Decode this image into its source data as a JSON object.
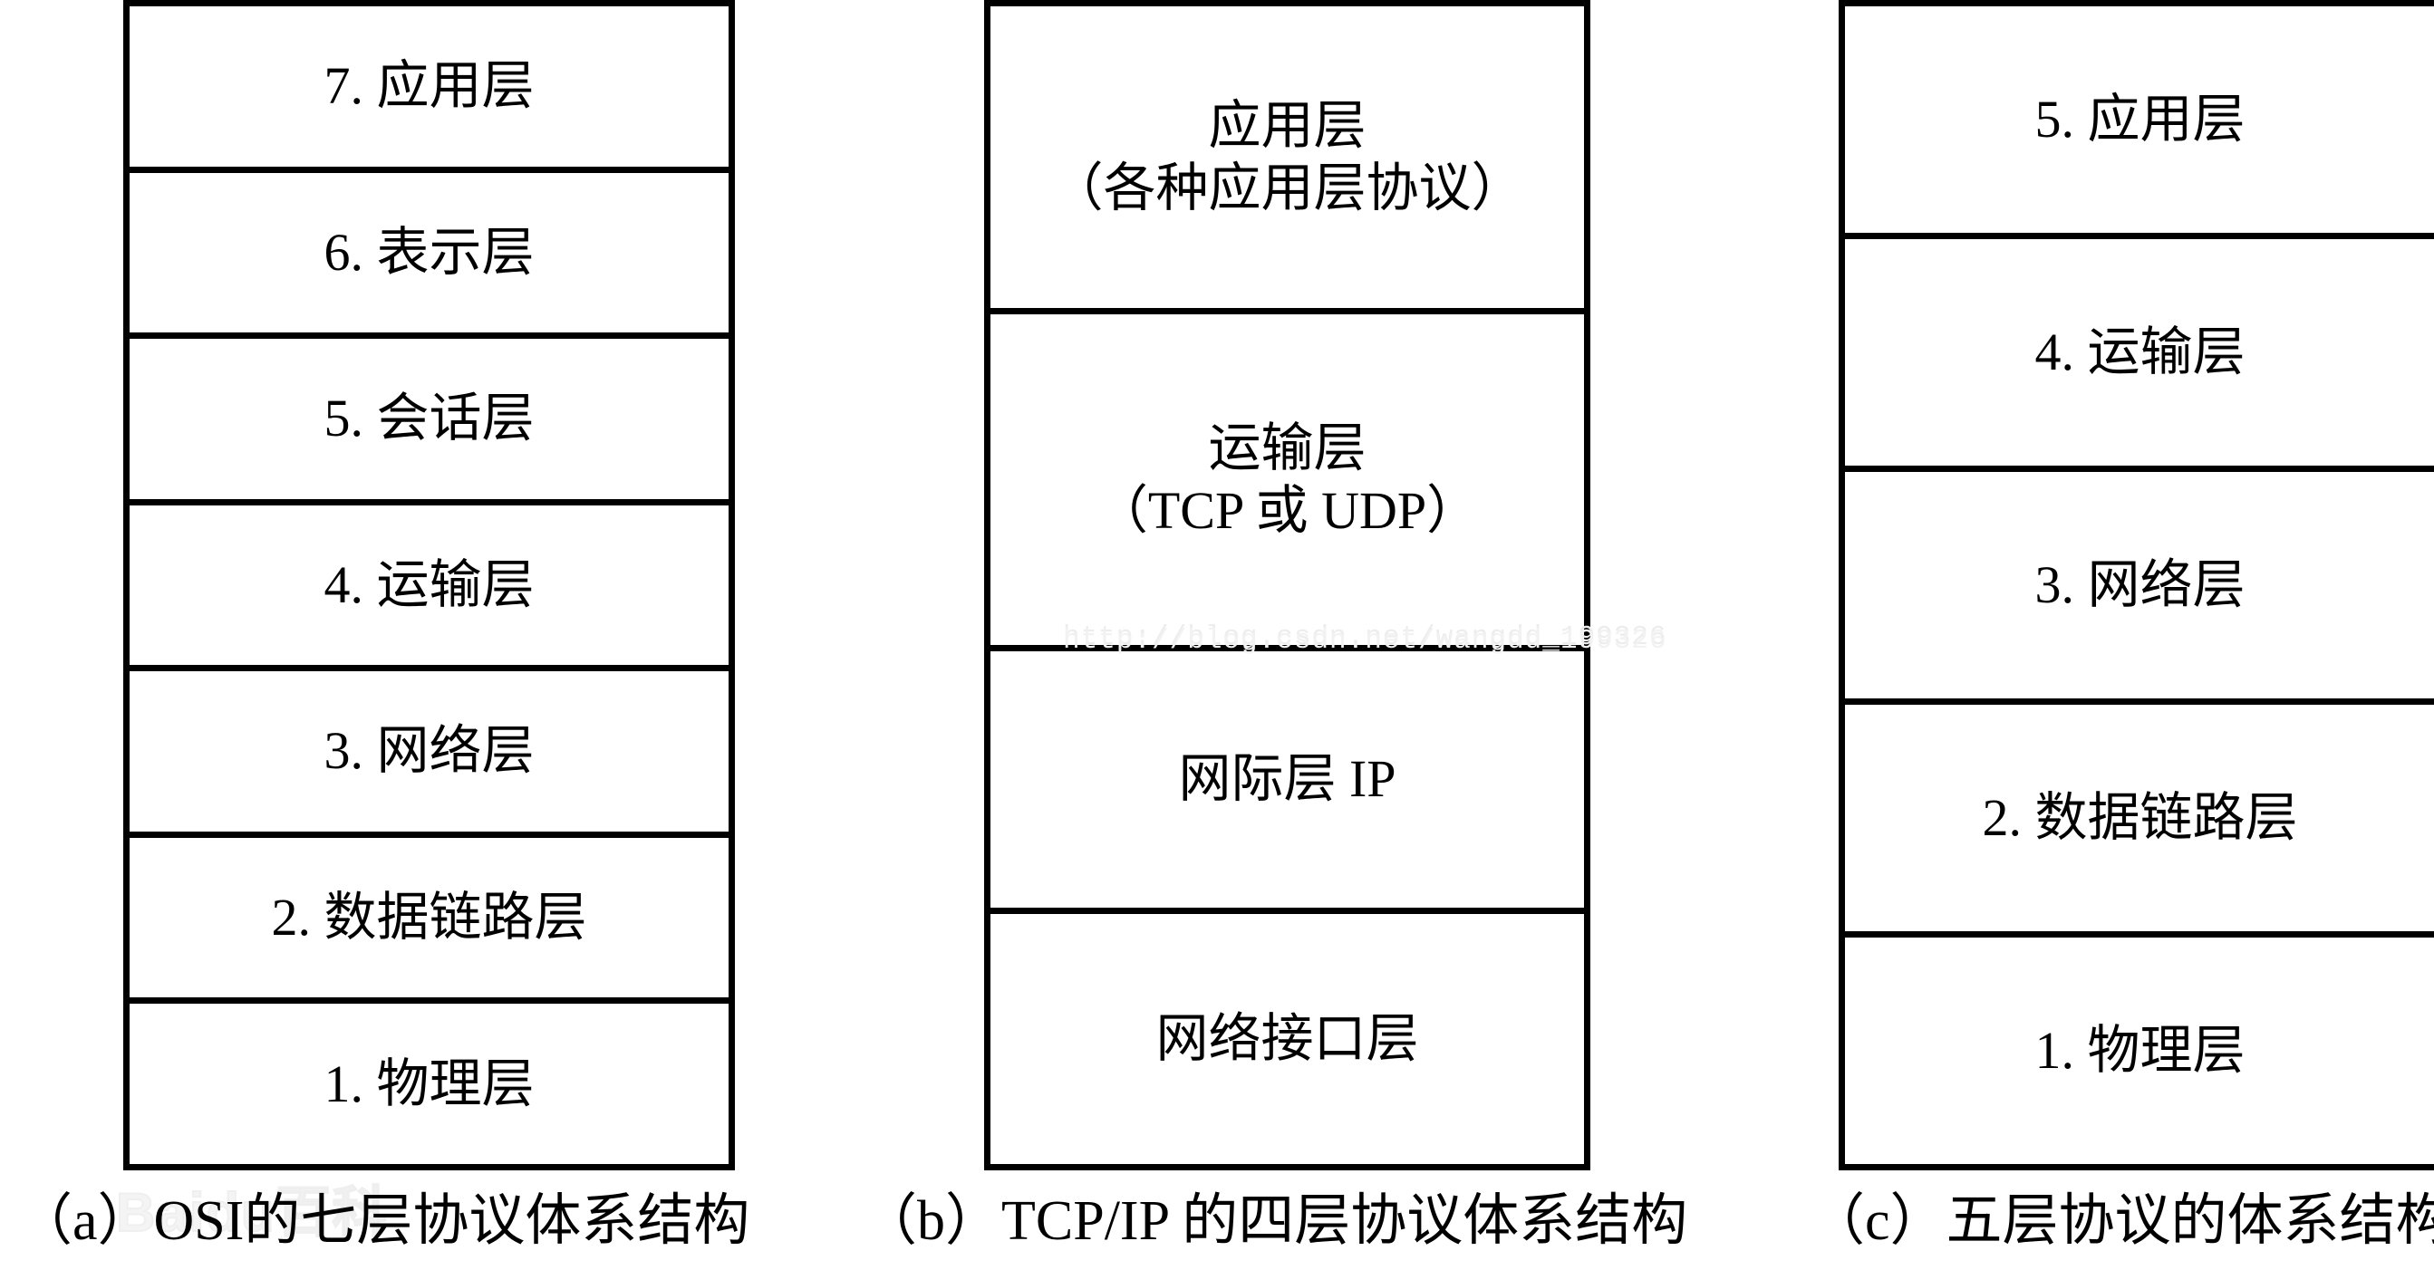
{
  "diagram": {
    "columns": [
      {
        "id": "a",
        "caption": "（a）OSI的七层协议体系结构",
        "layers": [
          {
            "lines": [
              "7. 应用层"
            ]
          },
          {
            "lines": [
              "6. 表示层"
            ]
          },
          {
            "lines": [
              "5. 会话层"
            ]
          },
          {
            "lines": [
              "4. 运输层"
            ]
          },
          {
            "lines": [
              "3. 网络层"
            ]
          },
          {
            "lines": [
              "2. 数据链路层"
            ]
          },
          {
            "lines": [
              "1. 物理层"
            ]
          }
        ]
      },
      {
        "id": "b",
        "caption": "（b）TCP/IP 的四层协议体系结构",
        "layers": [
          {
            "lines": [
              "应用层",
              "（各种应用层协议）"
            ]
          },
          {
            "lines": [
              "运输层",
              "（TCP 或 UDP）"
            ]
          },
          {
            "lines": [
              "网际层 IP"
            ]
          },
          {
            "lines": [
              "网络接口层"
            ]
          }
        ]
      },
      {
        "id": "c",
        "caption": "（c）五层协议的体系结构",
        "layers": [
          {
            "lines": [
              "5. 应用层"
            ]
          },
          {
            "lines": [
              "4. 运输层"
            ]
          },
          {
            "lines": [
              "3. 网络层"
            ]
          },
          {
            "lines": [
              "2. 数据链路层"
            ]
          },
          {
            "lines": [
              "1. 物理层"
            ]
          }
        ]
      }
    ]
  },
  "watermarks": {
    "csdn": "http://blog.csdn.net/wangdd_199326",
    "baidu": "Baidu百科"
  },
  "colors": {
    "border": "#000000",
    "background": "#ffffff",
    "text": "#000000",
    "watermark": "#eeeeee"
  }
}
